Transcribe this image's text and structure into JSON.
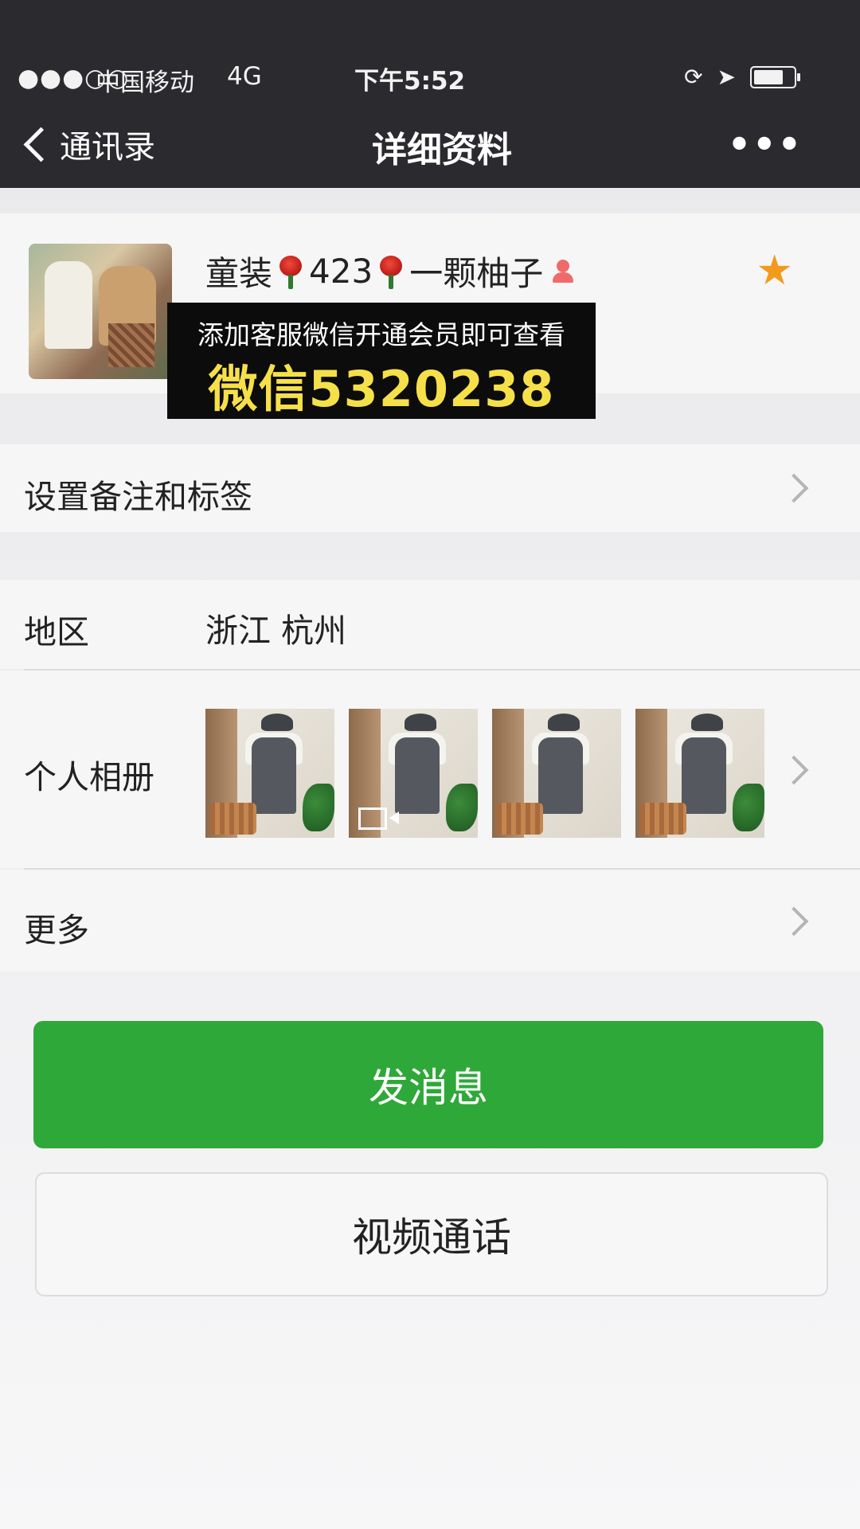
{
  "status_bar": {
    "signal": "●●●○○",
    "carrier": "中国移动",
    "network": "4G",
    "time": "下午5:52"
  },
  "nav": {
    "back_label": "通讯录",
    "title": "详细资料",
    "more_icon": "more-icon"
  },
  "profile": {
    "name_part1": "童装",
    "name_part2": "423",
    "name_part3": "一颗柚子",
    "starred": true
  },
  "overlay": {
    "line1": "添加客服微信开通会员即可查看",
    "line2": "微信5320238"
  },
  "cells": {
    "remark_label": "设置备注和标签",
    "region_label": "地区",
    "region_value": "浙江 杭州",
    "album_label": "个人相册",
    "more_label": "更多"
  },
  "buttons": {
    "send_message": "发消息",
    "video_call": "视频通话"
  },
  "colors": {
    "primary_green": "#2fa83a",
    "nav_bg": "#2b2b2f",
    "star": "#f19a1c",
    "overlay_highlight": "#f6e04a"
  }
}
